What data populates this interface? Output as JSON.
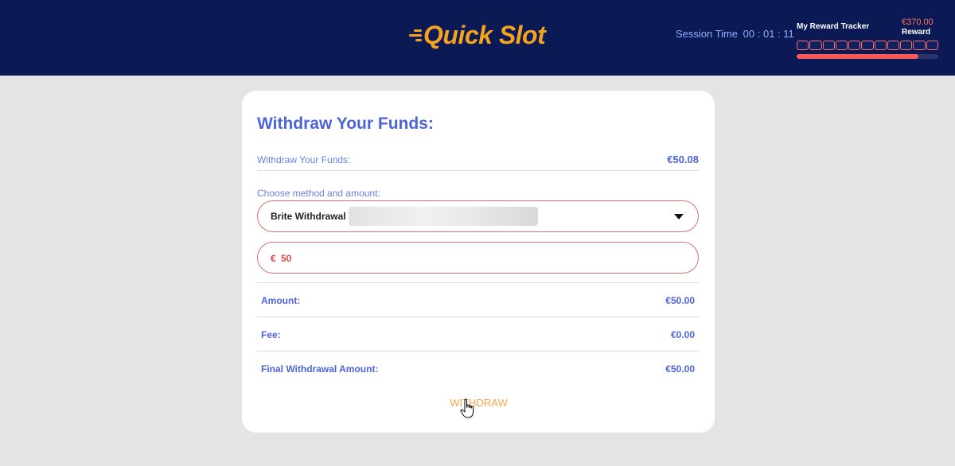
{
  "header": {
    "logo_text": "Quick Slot",
    "session_label": "Session Time",
    "session_time": "00 : 01 : 11",
    "tracker_title": "My Reward Tracker",
    "reward_amount": "€370.00",
    "reward_label": "Reward",
    "tracker_progress": 0.86,
    "accent_color": "#f5a21c",
    "header_bg": "#0b1a54"
  },
  "card": {
    "title": "Withdraw Your Funds:",
    "funds_label": "Withdraw Your Funds:",
    "funds_value": "€50.08",
    "choose_label": "Choose method and amount:",
    "method_selected": "Brite Withdrawal",
    "currency_symbol": "€",
    "amount_value": "50",
    "summary": {
      "amount_label": "Amount:",
      "amount_value": "€50.00",
      "fee_label": "Fee:",
      "fee_value": "€0.00",
      "final_label": "Final Withdrawal Amount:",
      "final_value": "€50.00"
    },
    "withdraw_label": "WITHDRAW"
  }
}
